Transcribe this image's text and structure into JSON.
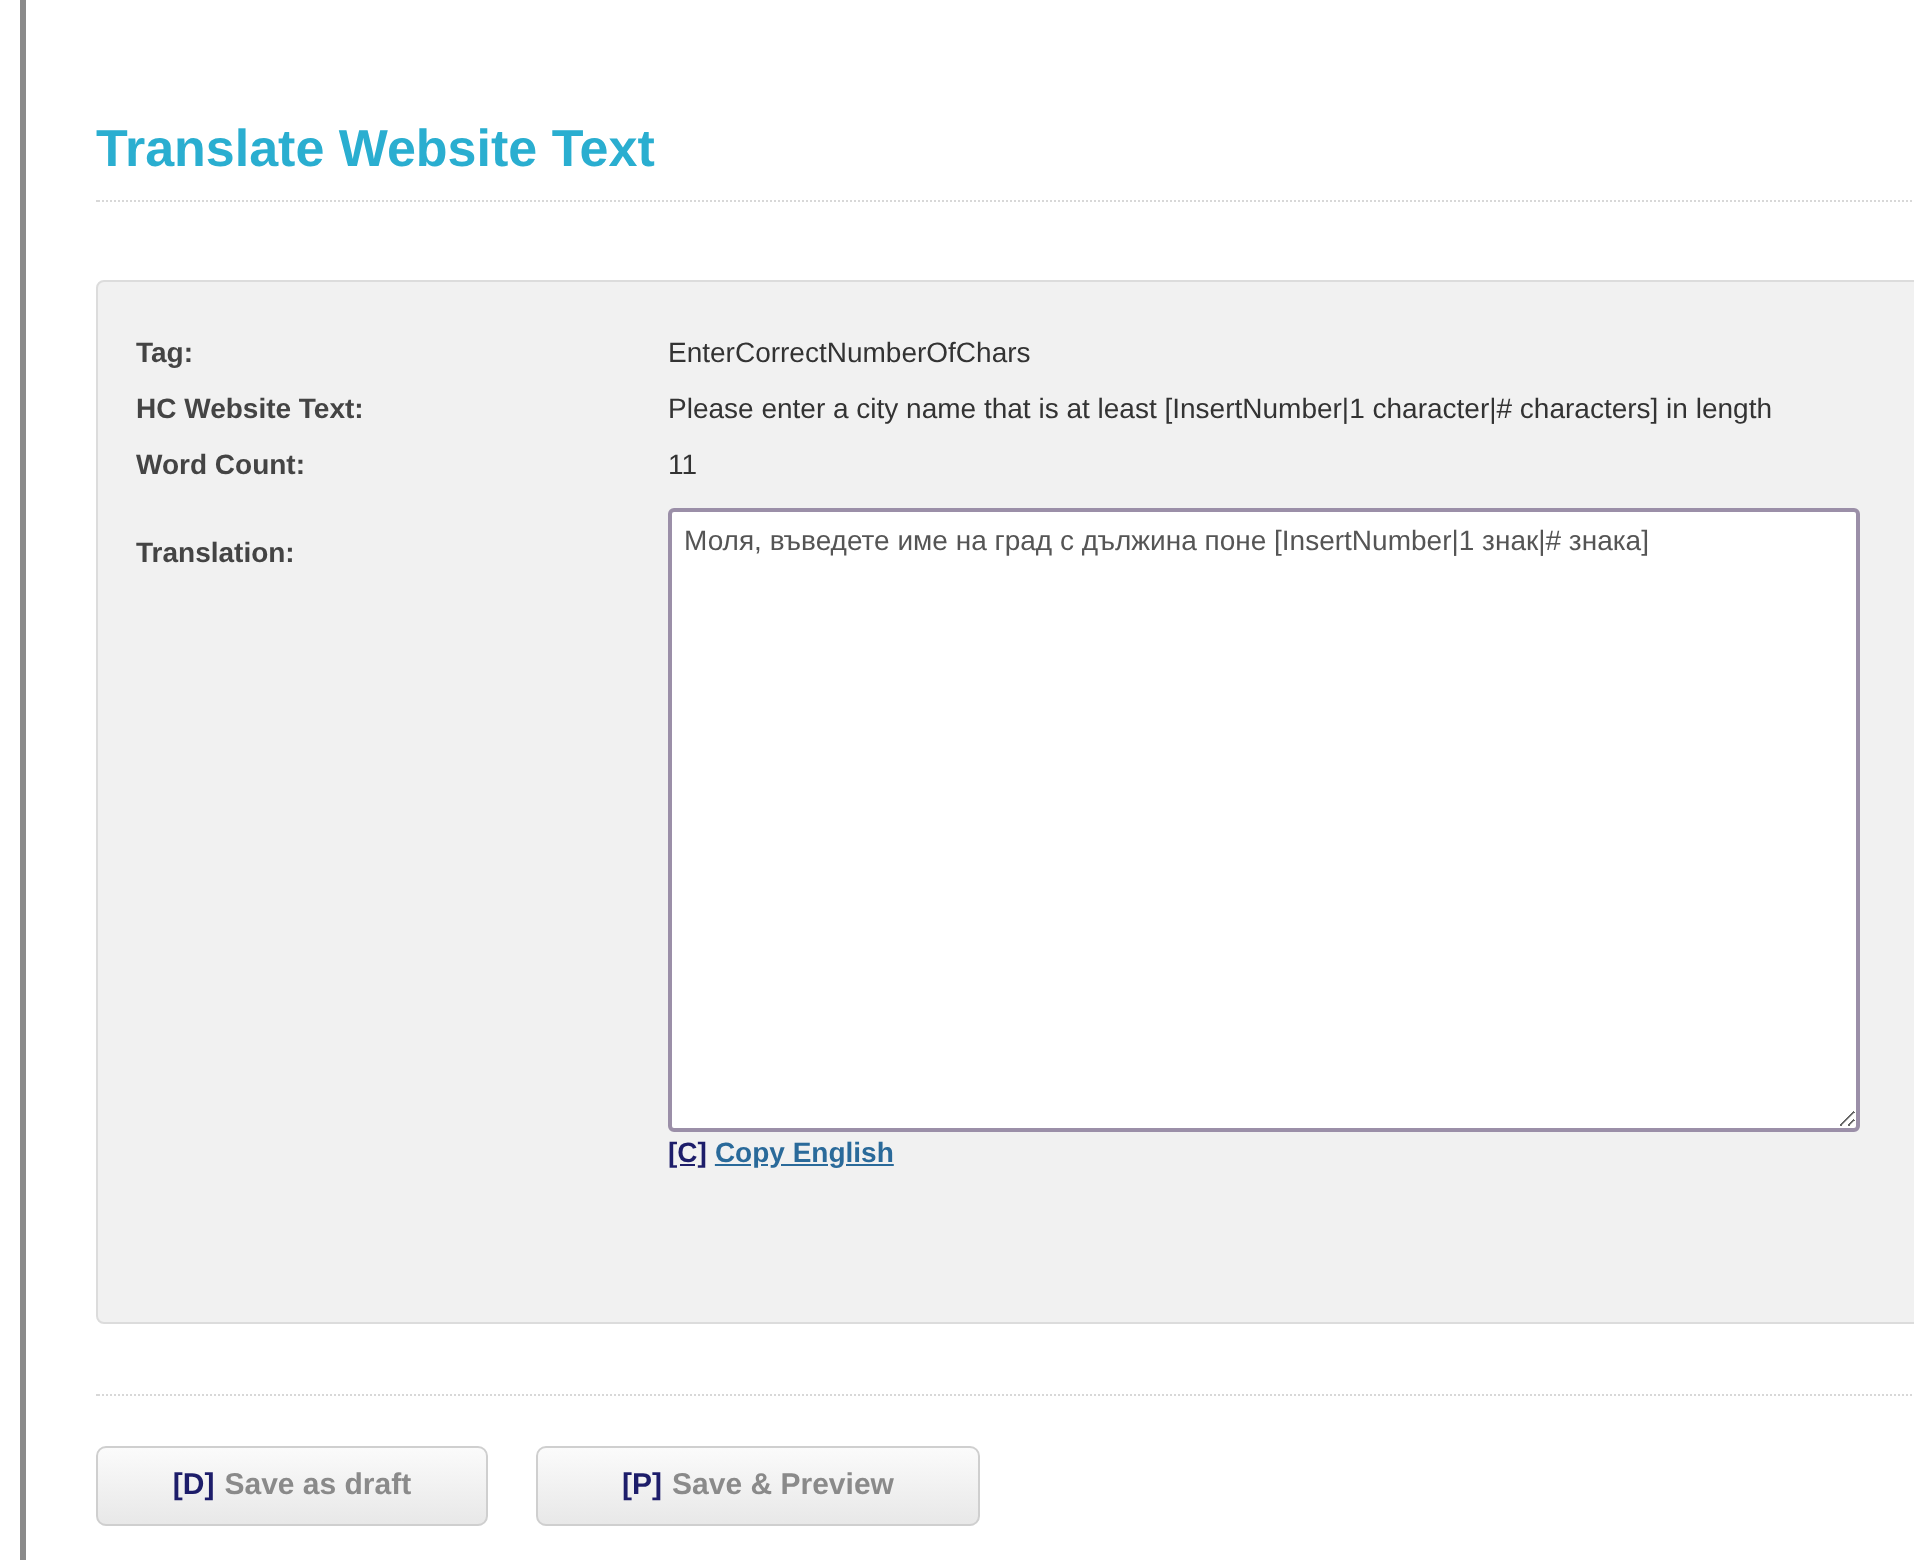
{
  "title": "Translate Website Text",
  "fields": [
    {
      "label": "Tag:",
      "value": "EnterCorrectNumberOfChars"
    },
    {
      "label": "HC Website Text:",
      "value": "Please enter a city name that is at least [InsertNumber|1 character|# characters] in length"
    },
    {
      "label": "Word Count:",
      "value": "11"
    }
  ],
  "translation": {
    "label": "Translation:",
    "value": "Моля, въведете име на град с дължина поне [InsertNumber|1 знак|# знака]"
  },
  "copy_link": {
    "key": "[C]",
    "label": "Copy English"
  },
  "buttons": [
    {
      "key": "[D]",
      "label": "Save as draft"
    },
    {
      "key": "[P]",
      "label": "Save & Preview"
    }
  ]
}
